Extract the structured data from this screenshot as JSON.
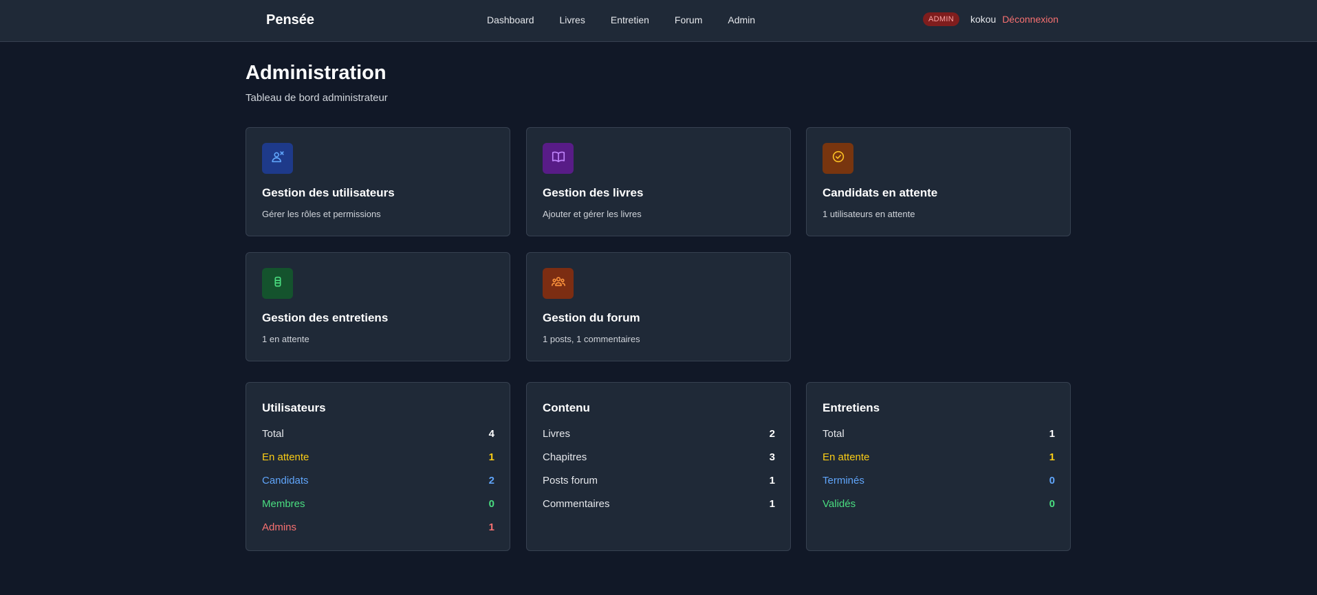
{
  "brand": "Pensée",
  "nav": {
    "links": [
      "Dashboard",
      "Livres",
      "Entretien",
      "Forum",
      "Admin"
    ],
    "role_badge": "ADMIN",
    "username": "kokou",
    "logout": "Déconnexion"
  },
  "header": {
    "title": "Administration",
    "subtitle": "Tableau de bord administrateur"
  },
  "action_cards": [
    {
      "title": "Gestion des utilisateurs",
      "desc": "Gérer les rôles et permissions",
      "icon": "user-manage-icon",
      "bg": "#1e3a8a",
      "fg": "#60a5fa"
    },
    {
      "title": "Gestion des livres",
      "desc": "Ajouter et gérer les livres",
      "icon": "book-icon",
      "bg": "#581c87",
      "fg": "#c084fc"
    },
    {
      "title": "Candidats en attente",
      "desc": "1 utilisateurs en attente",
      "icon": "check-circle-icon",
      "bg": "#78350f",
      "fg": "#fbbf24"
    },
    {
      "title": "Gestion des entretiens",
      "desc": "1 en attente",
      "icon": "interview-icon",
      "bg": "#14532d",
      "fg": "#4ade80"
    },
    {
      "title": "Gestion du forum",
      "desc": "1 posts, 1 commentaires",
      "icon": "group-icon",
      "bg": "#7c2d12",
      "fg": "#fb923c"
    }
  ],
  "stats_cards": [
    {
      "title": "Utilisateurs",
      "rows": [
        {
          "label": "Total",
          "value": "4",
          "color": "#e5e7eb",
          "value_color": "#ffffff"
        },
        {
          "label": "En attente",
          "value": "1",
          "color": "#facc15",
          "value_color": "#facc15"
        },
        {
          "label": "Candidats",
          "value": "2",
          "color": "#60a5fa",
          "value_color": "#60a5fa"
        },
        {
          "label": "Membres",
          "value": "0",
          "color": "#4ade80",
          "value_color": "#4ade80"
        },
        {
          "label": "Admins",
          "value": "1",
          "color": "#f87171",
          "value_color": "#f87171"
        }
      ]
    },
    {
      "title": "Contenu",
      "rows": [
        {
          "label": "Livres",
          "value": "2",
          "color": "#e5e7eb",
          "value_color": "#ffffff"
        },
        {
          "label": "Chapitres",
          "value": "3",
          "color": "#e5e7eb",
          "value_color": "#ffffff"
        },
        {
          "label": "Posts forum",
          "value": "1",
          "color": "#e5e7eb",
          "value_color": "#ffffff"
        },
        {
          "label": "Commentaires",
          "value": "1",
          "color": "#e5e7eb",
          "value_color": "#ffffff"
        }
      ]
    },
    {
      "title": "Entretiens",
      "rows": [
        {
          "label": "Total",
          "value": "1",
          "color": "#e5e7eb",
          "value_color": "#ffffff"
        },
        {
          "label": "En attente",
          "value": "1",
          "color": "#facc15",
          "value_color": "#facc15"
        },
        {
          "label": "Terminés",
          "value": "0",
          "color": "#60a5fa",
          "value_color": "#60a5fa"
        },
        {
          "label": "Validés",
          "value": "0",
          "color": "#4ade80",
          "value_color": "#4ade80"
        }
      ]
    }
  ]
}
